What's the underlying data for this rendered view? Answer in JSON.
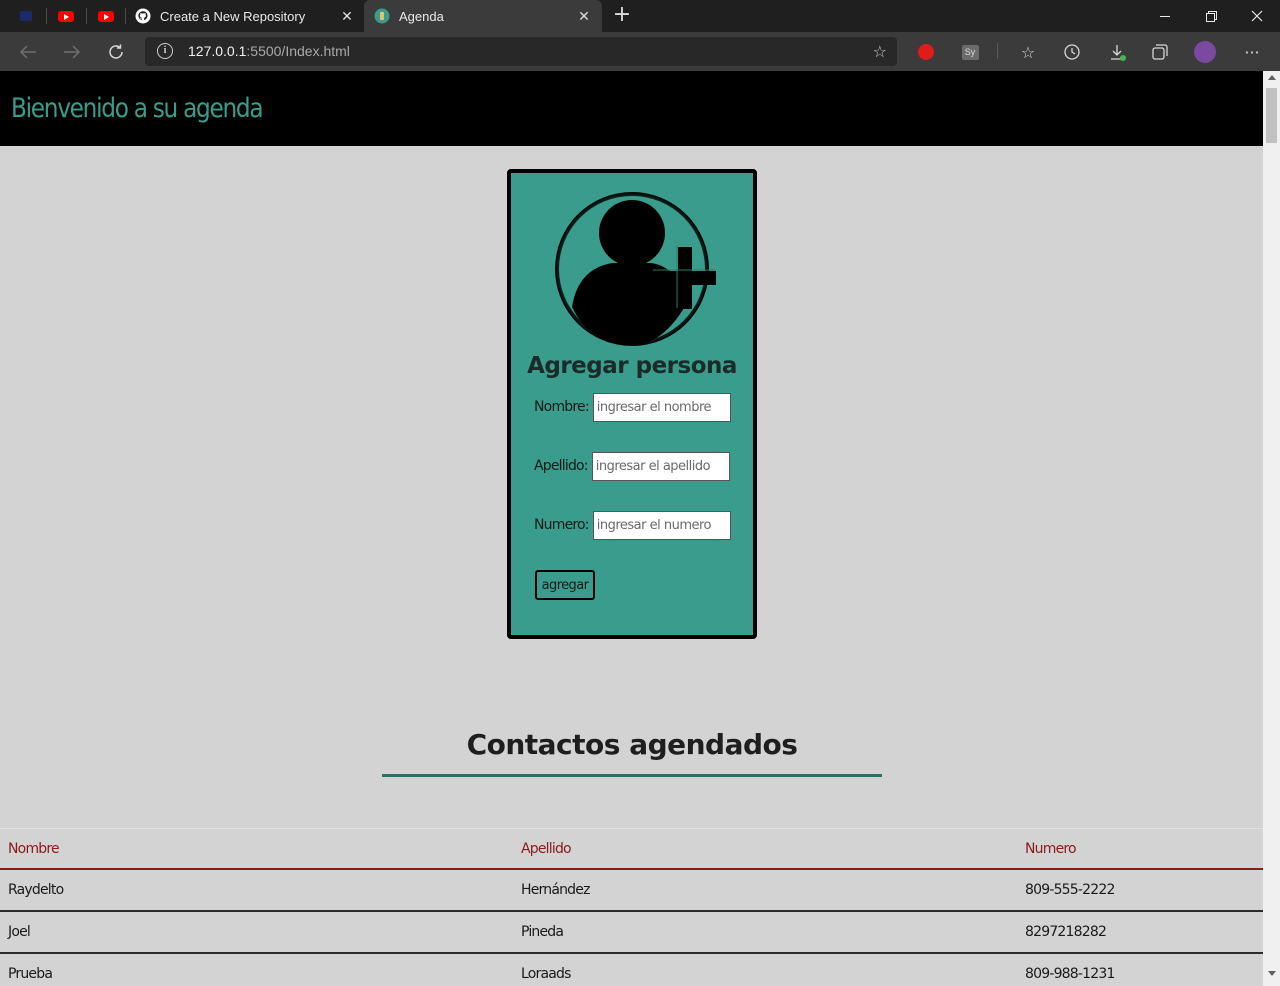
{
  "browser": {
    "tabs": [
      {
        "title": "Create a New Repository",
        "icon": "github-icon"
      },
      {
        "title": "Agenda",
        "icon": "agenda-favicon",
        "active": true
      }
    ],
    "url_host": "127.0.0.1",
    "url_rest": ":5500/Index.html",
    "profile_icon": "avatar"
  },
  "page": {
    "header_title": "Bienvenido a su agenda",
    "form": {
      "title": "Agregar persona",
      "fields": [
        {
          "label": "Nombre:",
          "placeholder": "ingresar el nombre"
        },
        {
          "label": "Apellido:",
          "placeholder": "ingresar el apellido"
        },
        {
          "label": "Numero:",
          "placeholder": "ingresar el numero"
        }
      ],
      "submit_label": "agregar"
    },
    "contacts_title": "Contactos agendados",
    "table": {
      "headers": [
        "Nombre",
        "Apellido",
        "Numero"
      ],
      "rows": [
        [
          "Raydelto",
          "Hernández",
          "809-555-2222"
        ],
        [
          "Joel",
          "Pineda",
          "8297218282"
        ],
        [
          "Prueba",
          "Loraads",
          "809-988-1231"
        ]
      ]
    }
  },
  "colors": {
    "accent_teal": "#3a9c8c",
    "header_bg": "#000000",
    "table_header_text": "#8b1a1a",
    "page_bg": "#d3d3d3"
  }
}
